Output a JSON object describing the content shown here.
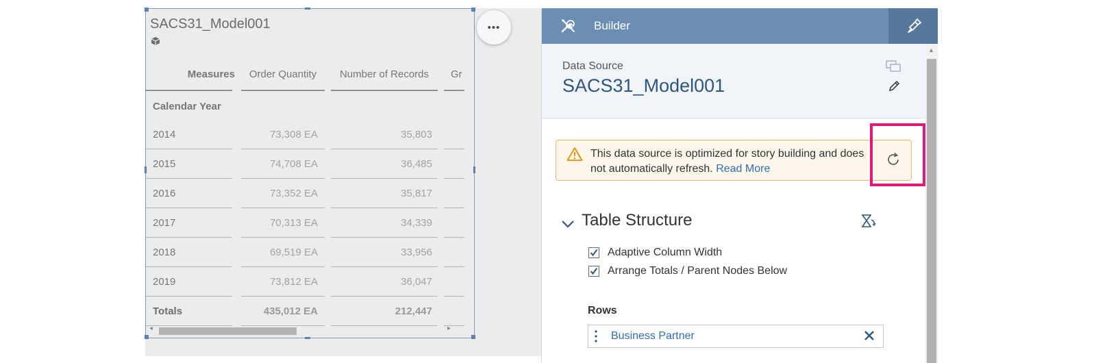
{
  "widget": {
    "title": "SACS31_Model001",
    "model_icon": "cube-icon",
    "headers": {
      "measures": "Measures",
      "order_quantity": "Order Quantity",
      "number_of_records": "Number of Records",
      "gr_partial": "Gr"
    },
    "dimension_label": "Calendar Year",
    "rows": [
      {
        "year": "2014",
        "order_qty": "73,308 EA",
        "records": "35,803"
      },
      {
        "year": "2015",
        "order_qty": "74,708 EA",
        "records": "36,485"
      },
      {
        "year": "2016",
        "order_qty": "73,352 EA",
        "records": "35,817"
      },
      {
        "year": "2017",
        "order_qty": "70,313 EA",
        "records": "34,339"
      },
      {
        "year": "2018",
        "order_qty": "69,519 EA",
        "records": "33,956"
      },
      {
        "year": "2019",
        "order_qty": "73,812 EA",
        "records": "36,047"
      }
    ],
    "totals": {
      "label": "Totals",
      "order_qty": "435,012 EA",
      "records": "212,447"
    },
    "more_button": "•••"
  },
  "builder": {
    "title": "Builder",
    "data_source_label": "Data Source",
    "data_source_name": "SACS31_Model001",
    "warning": {
      "text": "This data source is optimized for story building and does not automatically refresh. ",
      "link": "Read More"
    },
    "table_structure_title": "Table Structure",
    "checkboxes": [
      {
        "label": "Adaptive Column Width",
        "checked": true
      },
      {
        "label": "Arrange Totals / Parent Nodes Below",
        "checked": true
      }
    ],
    "rows_label": "Rows",
    "rows_items": [
      {
        "label": "Business Partner"
      }
    ]
  },
  "colors": {
    "header_blue": "#6b8eb4",
    "accent_blue": "#2c5680",
    "link_blue": "#2d6eb6",
    "warning_border": "#f2b56b",
    "highlight_pink": "#e0197a"
  }
}
